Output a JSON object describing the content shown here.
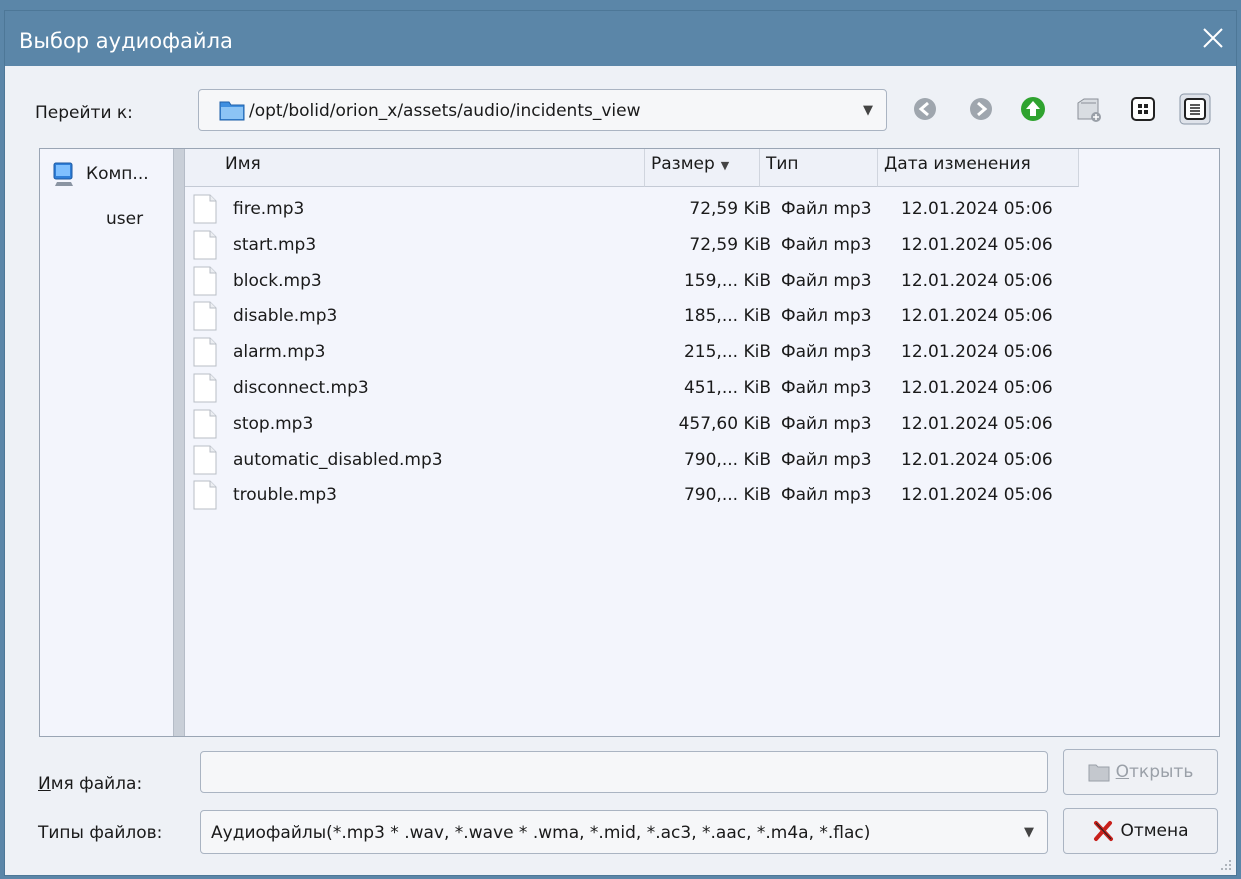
{
  "window": {
    "title": "Выбор аудиофайла"
  },
  "goto": {
    "label": "Перейти к:",
    "path": "/opt/bolid/orion_x/assets/audio/incidents_view"
  },
  "toolbar": {
    "icons": [
      "back-icon",
      "forward-icon",
      "parent-dir-icon",
      "new-folder-icon",
      "icon-view-icon",
      "detail-view-icon"
    ]
  },
  "places": [
    {
      "label": "Комп...",
      "icon": "computer-icon"
    },
    {
      "label": "user"
    }
  ],
  "columns": {
    "name": "Имя",
    "size": "Размер",
    "type": "Тип",
    "date": "Дата изменения"
  },
  "files": [
    {
      "name": "fire.mp3",
      "size": "72,59 KiB",
      "type": "Файл mp3",
      "date": "12.01.2024 05:06"
    },
    {
      "name": "start.mp3",
      "size": "72,59 KiB",
      "type": "Файл mp3",
      "date": "12.01.2024 05:06"
    },
    {
      "name": "block.mp3",
      "size": "159,... KiB",
      "type": "Файл mp3",
      "date": "12.01.2024 05:06"
    },
    {
      "name": "disable.mp3",
      "size": "185,... KiB",
      "type": "Файл mp3",
      "date": "12.01.2024 05:06"
    },
    {
      "name": "alarm.mp3",
      "size": "215,... KiB",
      "type": "Файл mp3",
      "date": "12.01.2024 05:06"
    },
    {
      "name": "disconnect.mp3",
      "size": "451,... KiB",
      "type": "Файл mp3",
      "date": "12.01.2024 05:06"
    },
    {
      "name": "stop.mp3",
      "size": "457,60 KiB",
      "type": "Файл mp3",
      "date": "12.01.2024 05:06"
    },
    {
      "name": "automatic_disabled.mp3",
      "size": "790,... KiB",
      "type": "Файл mp3",
      "date": "12.01.2024 05:06"
    },
    {
      "name": "trouble.mp3",
      "size": "790,... KiB",
      "type": "Файл mp3",
      "date": "12.01.2024 05:06"
    }
  ],
  "filename": {
    "label_first": "И",
    "label_rest": "мя файла:",
    "value": ""
  },
  "open_button": {
    "label_first": "О",
    "label_rest": "ткрыть"
  },
  "filetypes": {
    "label": "Типы файлов:",
    "value": "Аудиофайлы(*.mp3 * .wav, *.wave * .wma, *.mid, *.ac3, *.aac, *.m4a, *.flac)"
  },
  "cancel_button": {
    "label": "Отмена"
  },
  "colors": {
    "titlebar": "#5b86a8",
    "background": "#eef1f6",
    "list": "#f3f5fc"
  }
}
